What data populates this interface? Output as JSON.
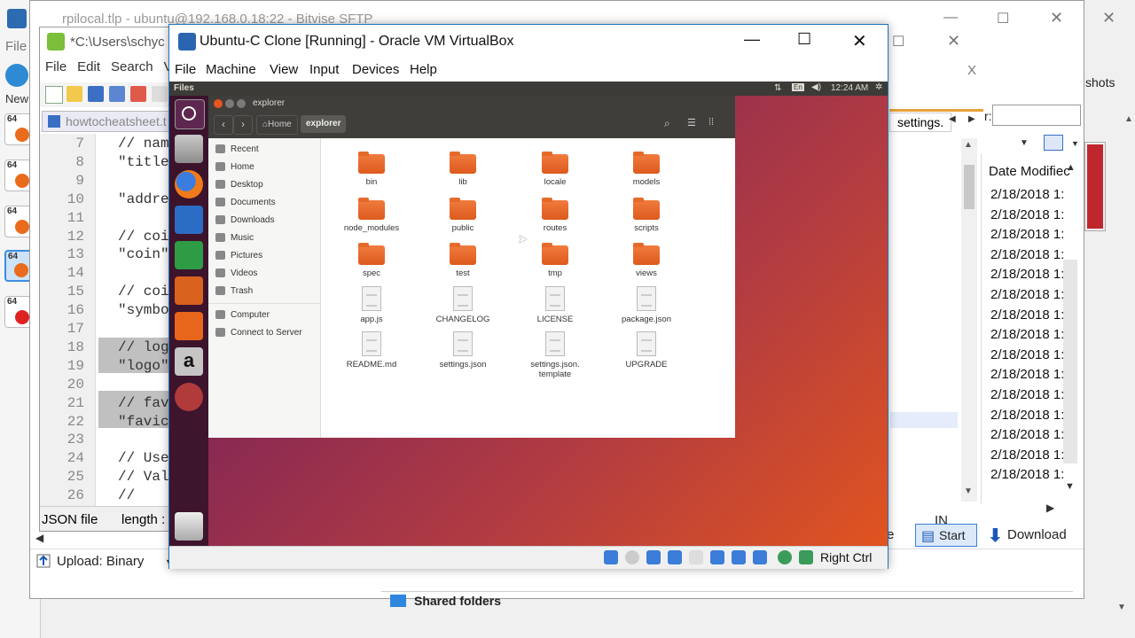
{
  "bitvise": {
    "title": "rpilocal.tlp - ubuntu@192.168.0.18:22 - Bitvise SFTP",
    "file_menu": "File",
    "new_label": "New",
    "shots_label": "shots",
    "settings_tab": "settings.",
    "filter_label": "r:",
    "date_header": "Date Modifiec",
    "dates": [
      "2/18/2018 1:",
      "2/18/2018 1:",
      "2/18/2018 1:",
      "2/18/2018 1:",
      "2/18/2018 1:",
      "2/18/2018 1:",
      "2/18/2018 1:",
      "2/18/2018 1:",
      "2/18/2018 1:",
      "2/18/2018 1:",
      "2/18/2018 1:",
      "2/18/2018 1:",
      "2/18/2018 1:",
      "2/18/2018 1:",
      "2/18/2018 1:"
    ],
    "start_label": "Start",
    "download_label": "Download",
    "upload_label": "Upload: Binary",
    "shared_folders": "Shared folders",
    "in_label": "IN",
    "e_label": "e",
    "x_label": "X"
  },
  "notepad": {
    "path": "*C:\\Users\\schyc",
    "menu": [
      "File",
      "Edit",
      "Search",
      "Vi"
    ],
    "tab": "howtocheatsheet.t",
    "lines": [
      {
        "n": "7",
        "t": "// nam"
      },
      {
        "n": "8",
        "t": "\"title"
      },
      {
        "n": "9",
        "t": ""
      },
      {
        "n": "10",
        "t": "\"addre"
      },
      {
        "n": "11",
        "t": ""
      },
      {
        "n": "12",
        "t": "// coi"
      },
      {
        "n": "13",
        "t": "\"coin\""
      },
      {
        "n": "14",
        "t": ""
      },
      {
        "n": "15",
        "t": "// coi"
      },
      {
        "n": "16",
        "t": "\"symbo"
      },
      {
        "n": "17",
        "t": ""
      },
      {
        "n": "18",
        "t": "// log"
      },
      {
        "n": "19",
        "t": "\"logo\""
      },
      {
        "n": "20",
        "t": ""
      },
      {
        "n": "21",
        "t": "// fav"
      },
      {
        "n": "22",
        "t": "\"favic"
      },
      {
        "n": "23",
        "t": ""
      },
      {
        "n": "24",
        "t": "// Use"
      },
      {
        "n": "25",
        "t": "// Val"
      },
      {
        "n": "26",
        "t": "//"
      }
    ],
    "status_type": "JSON file",
    "status_length": "length :"
  },
  "vbox": {
    "title": "Ubuntu-C Clone [Running] - Oracle VM VirtualBox",
    "menu": [
      "File",
      "Machine",
      "View",
      "Input",
      "Devices",
      "Help"
    ],
    "host_key": "Right Ctrl"
  },
  "ubuntu": {
    "app_name": "Files",
    "clock": "12:24 AM",
    "lang": "En"
  },
  "nautilus": {
    "window_title": "explorer",
    "crumb_home": "Home",
    "crumb_current": "explorer",
    "sidebar": [
      "Recent",
      "Home",
      "Desktop",
      "Documents",
      "Downloads",
      "Music",
      "Pictures",
      "Videos",
      "Trash"
    ],
    "sidebar2": [
      "Computer",
      "Connect to Server"
    ],
    "folders": [
      "bin",
      "lib",
      "locale",
      "models",
      "node_modules",
      "public",
      "routes",
      "scripts",
      "spec",
      "test",
      "tmp",
      "views"
    ],
    "files": [
      "app.js",
      "CHANGELOG",
      "LICENSE",
      "package.json",
      "README.md",
      "settings.json",
      "settings.json.\ntemplate",
      "UPGRADE"
    ]
  }
}
